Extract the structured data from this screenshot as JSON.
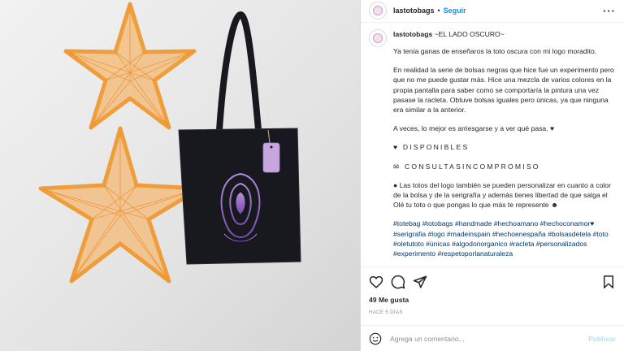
{
  "header": {
    "username": "lastotobags",
    "separator": "•",
    "follow_label": "Seguir",
    "more_label": "···"
  },
  "caption": {
    "username": "lastotobags",
    "title": "~EL LADO OSCURO~",
    "paragraphs": [
      "Ya tenía ganas de enseñaros la toto oscura con mi logo moradito.",
      "En realidad la serie de bolsas negras que hice fue un experimento pero que no me puede gustar más. Hice una mezcla de varios colores en la propia pantalla para saber como se comportaría la pintura una vez pasase la racleta. Obtuve bolsas iguales pero únicas, ya que ninguna era similar a la anterior.",
      "A veces, lo mejor es arriesgarse y a ver qué pasa. ♥",
      "♥ DISPONIBLES",
      "✉ CONSULTASINCOMPROMISO",
      "● Las totos del logo también se pueden personalizar en cuanto a color de la bolsa y de la serigrafía y además tienes libertad de que salga el Olé tu toto o que pongas lo que más te represente ☻"
    ],
    "hashtags": "#totebag #totobags #handmade #hechoamano #hechoconamor♥ #serigrafia #logo #madeinspain #hechoenespaña #bolsasdetela #toto #oletutoto #únicas #algodonorganico #racleta #personalizados #experimento #respetoporlanaturaleza"
  },
  "stats": {
    "likes": "49 Me gusta",
    "time_ago": "HACE 5 DÍAS"
  },
  "comment": {
    "placeholder": "Agrega un comentario...",
    "publish_label": "Publicar"
  },
  "icons": {
    "like": "heart-icon",
    "comment": "comment-icon",
    "share": "share-icon",
    "save": "bookmark-icon",
    "emoji": "emoji-icon"
  },
  "colors": {
    "link": "#0095f6",
    "hashtag": "#00376b",
    "bag": "#18181f",
    "logo": "#9b6bc9",
    "star": "#f5a64a"
  }
}
